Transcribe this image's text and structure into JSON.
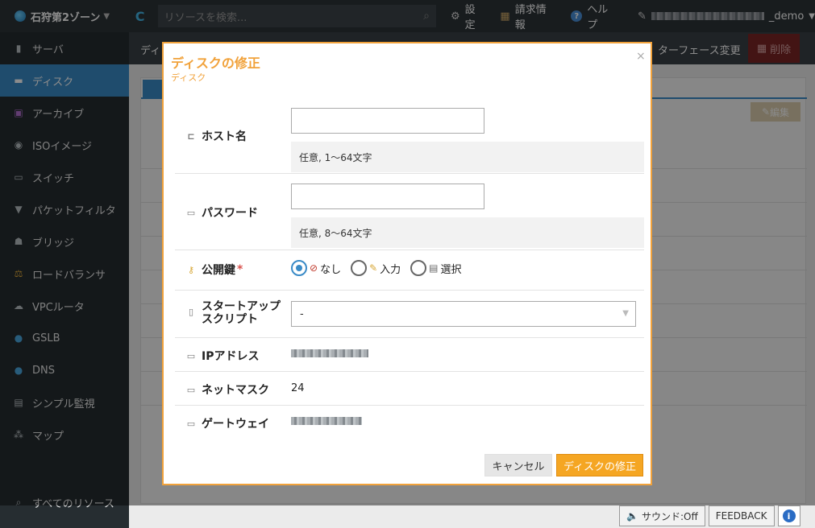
{
  "topbar": {
    "zone": "石狩第2ゾーン",
    "search_placeholder": "リソースを検索...",
    "settings": "設定",
    "billing": "請求情報",
    "help": "ヘルプ",
    "user_suffix": "_demo"
  },
  "sidebar": {
    "items": [
      {
        "label": "サーバ",
        "icon": "server-icon"
      },
      {
        "label": "ディスク",
        "icon": "disk-icon"
      },
      {
        "label": "アーカイブ",
        "icon": "archive-icon"
      },
      {
        "label": "ISOイメージ",
        "icon": "cd-icon"
      },
      {
        "label": "スイッチ",
        "icon": "switch-icon"
      },
      {
        "label": "パケットフィルタ",
        "icon": "filter-icon"
      },
      {
        "label": "ブリッジ",
        "icon": "bridge-icon"
      },
      {
        "label": "ロードバランサ",
        "icon": "balance-icon"
      },
      {
        "label": "VPCルータ",
        "icon": "router-icon"
      },
      {
        "label": "GSLB",
        "icon": "globe-icon"
      },
      {
        "label": "DNS",
        "icon": "globe-icon"
      },
      {
        "label": "シンプル監視",
        "icon": "monitor-icon"
      },
      {
        "label": "マップ",
        "icon": "map-icon"
      }
    ],
    "all_resources": "すべてのリソース"
  },
  "background": {
    "subbar_left": "ディ",
    "subbar_right": "ターフェース変更",
    "delete": "削除",
    "edit": "編集"
  },
  "modal": {
    "title": "ディスクの修正",
    "subtitle": "ディスク",
    "close": "×",
    "hostname": {
      "label": "ホスト名",
      "value": "",
      "hint": "任意, 1〜64文字"
    },
    "password": {
      "label": "パスワード",
      "value": "",
      "hint": "任意, 8〜64文字"
    },
    "pubkey": {
      "label": "公開鍵",
      "required": "*",
      "options": [
        "なし",
        "入力",
        "選択"
      ],
      "selected": "なし"
    },
    "startup": {
      "label_line1": "スタートアップ",
      "label_line2": "スクリプト",
      "selected": "-"
    },
    "ip": {
      "label": "IPアドレス"
    },
    "netmask": {
      "label": "ネットマスク",
      "value": "24"
    },
    "gateway": {
      "label": "ゲートウェイ"
    },
    "cancel": "キャンセル",
    "submit": "ディスクの修正"
  },
  "status": {
    "sound": "サウンド:Off",
    "feedback": "FEEDBACK",
    "info": "i"
  },
  "colors": {
    "accent": "#f1a23b",
    "primary": "#3a8bc7",
    "topbar": "#2c3338",
    "sidebar": "#262d31"
  }
}
